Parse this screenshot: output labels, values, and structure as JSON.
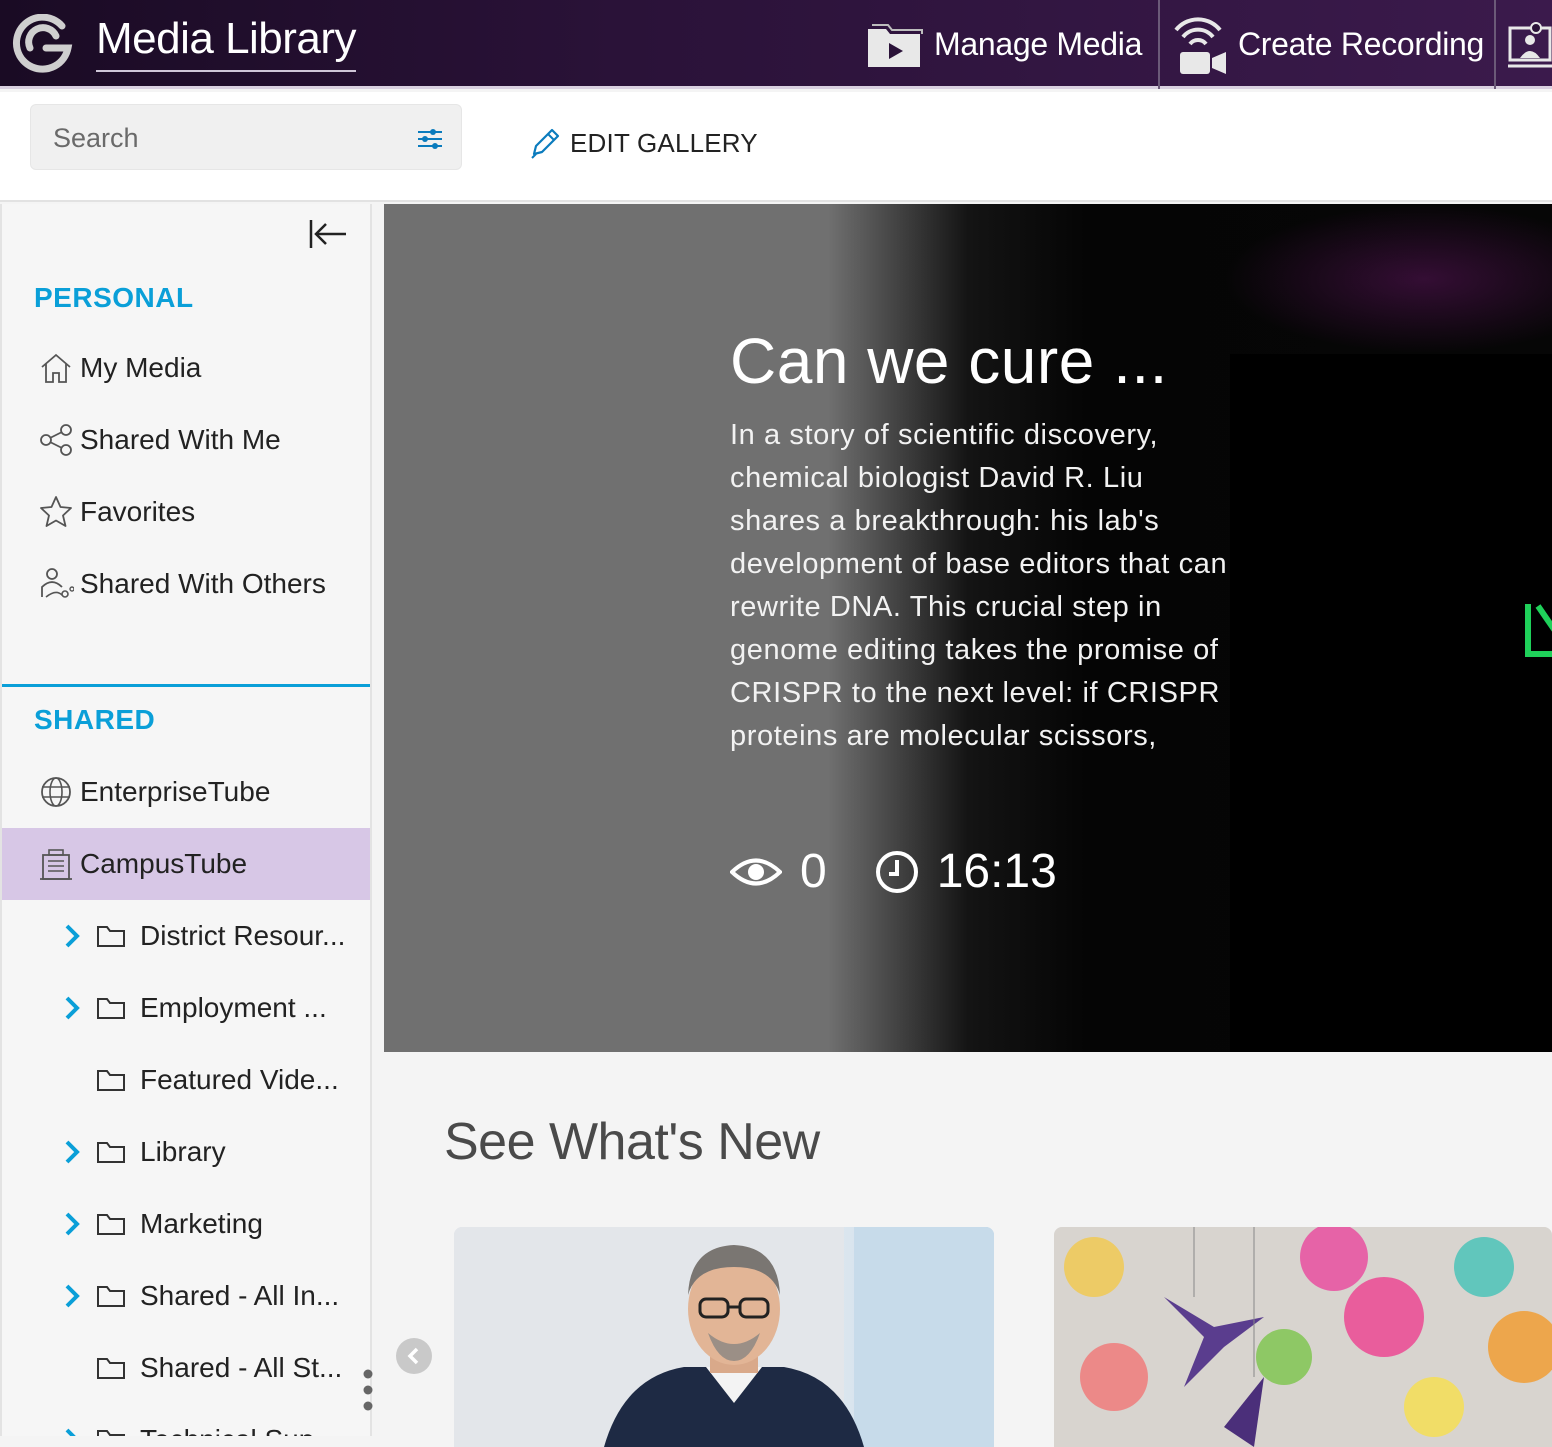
{
  "header": {
    "app_title": "Media Library",
    "nav": [
      {
        "label": "Manage Media",
        "icon": "folder-play-icon"
      },
      {
        "label": "Create Recording",
        "icon": "recording-camera-icon"
      },
      {
        "label": "",
        "icon": "presenter-icon"
      }
    ]
  },
  "toolbar": {
    "search_placeholder": "Search",
    "edit_gallery_label": "EDIT GALLERY"
  },
  "sidebar": {
    "personal_title": "PERSONAL",
    "personal_items": [
      {
        "label": "My Media",
        "icon": "home-icon"
      },
      {
        "label": "Shared With Me",
        "icon": "share-icon"
      },
      {
        "label": "Favorites",
        "icon": "star-icon"
      },
      {
        "label": "Shared With Others",
        "icon": "shared-users-icon"
      }
    ],
    "shared_title": "SHARED",
    "shared_items": [
      {
        "label": "EnterpriseTube",
        "icon": "globe-icon"
      },
      {
        "label": "CampusTube",
        "icon": "building-icon",
        "active": true
      }
    ],
    "tree": [
      {
        "label": "District Resour...",
        "expandable": true
      },
      {
        "label": "Employment ...",
        "expandable": true
      },
      {
        "label": "Featured Vide...",
        "expandable": false
      },
      {
        "label": "Library",
        "expandable": true
      },
      {
        "label": "Marketing",
        "expandable": true
      },
      {
        "label": "Shared - All In...",
        "expandable": true
      },
      {
        "label": "Shared - All St...",
        "expandable": false
      },
      {
        "label": "Technical Sup...",
        "expandable": true
      }
    ]
  },
  "hero": {
    "title": "Can we cure ...",
    "description": "In a story of scientific discovery, chemical biologist David R. Liu shares a breakthrough: his lab's development of base editors that can rewrite DNA. This crucial step in genome editing takes the promise of CRISPR to the next level: if CRISPR proteins are molecular scissors,",
    "views": "0",
    "duration": "16:13"
  },
  "section": {
    "title": "See What's New"
  },
  "colors": {
    "accent": "#0a9fd8",
    "active_item": "#d7c7e6",
    "header_bg": "#2a1238"
  }
}
